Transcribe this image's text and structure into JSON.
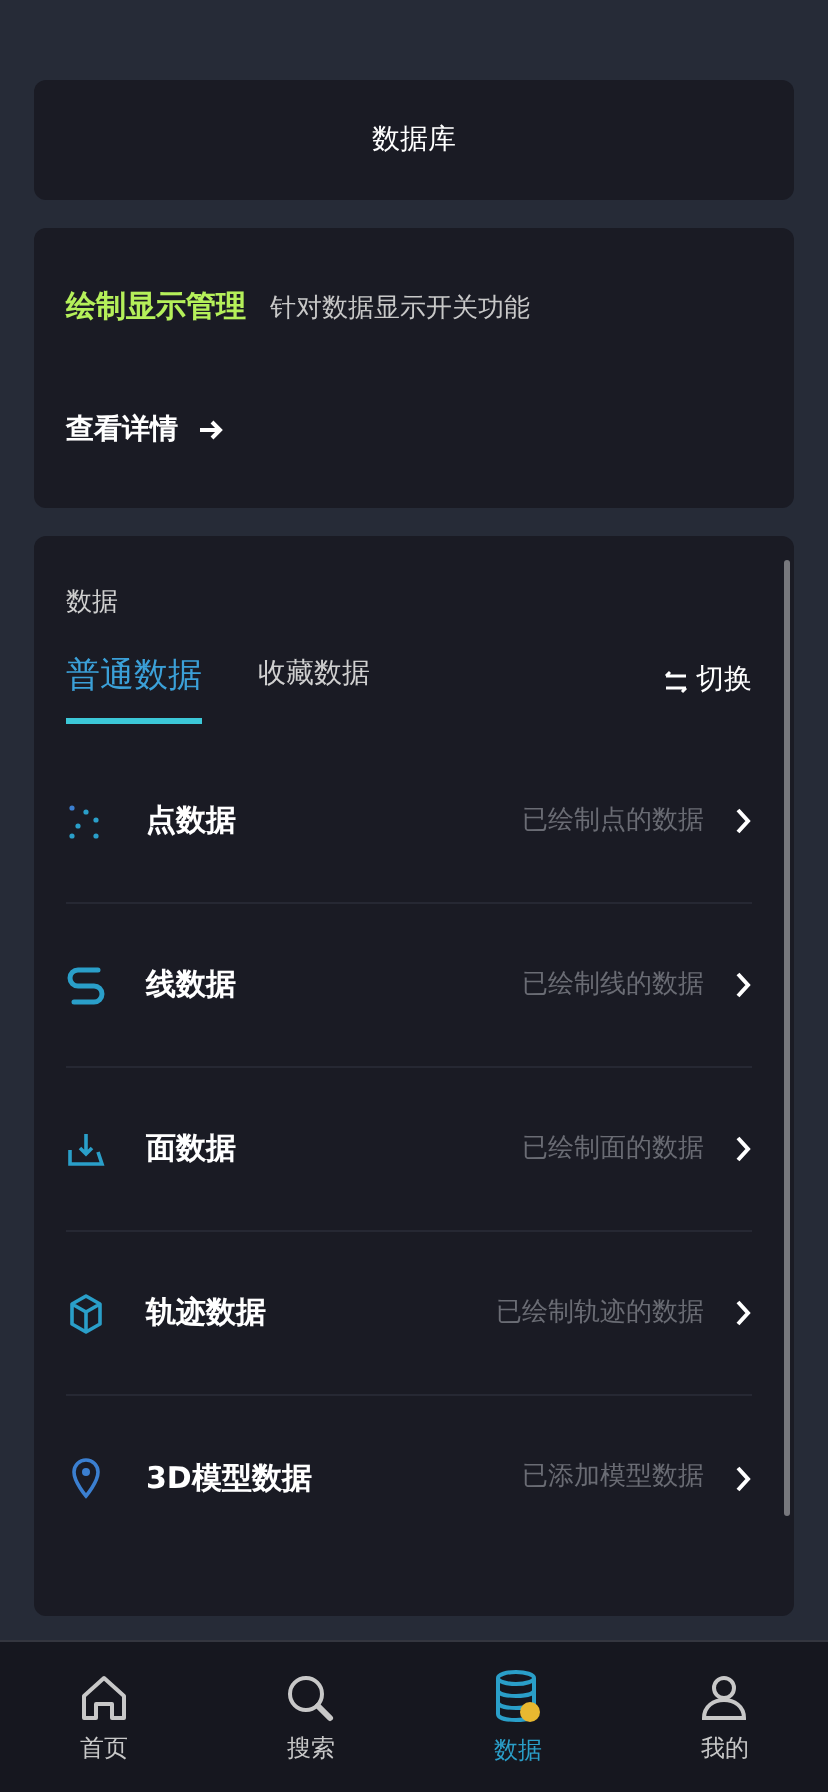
{
  "header": {
    "title": "数据库"
  },
  "draw_card": {
    "title": "绘制显示管理",
    "description": "针对数据显示开关功能",
    "link": "查看详情"
  },
  "data_panel": {
    "heading": "数据",
    "tabs": [
      {
        "label": "普通数据",
        "selected": true
      },
      {
        "label": "收藏数据",
        "selected": false
      }
    ],
    "switch_label": "切换",
    "rows": [
      {
        "kind": "point",
        "name": "点数据",
        "status": "已绘制点的数据"
      },
      {
        "kind": "line",
        "name": "线数据",
        "status": "已绘制线的数据"
      },
      {
        "kind": "area",
        "name": "面数据",
        "status": "已绘制面的数据"
      },
      {
        "kind": "track",
        "name": "轨迹数据",
        "status": "已绘制轨迹的数据"
      },
      {
        "kind": "model",
        "name": "3D模型数据",
        "status": "已添加模型数据"
      }
    ]
  },
  "bottom_nav": [
    {
      "kind": "home",
      "label": "首页",
      "selected": false
    },
    {
      "kind": "search",
      "label": "搜索",
      "selected": false
    },
    {
      "kind": "data",
      "label": "数据",
      "selected": true
    },
    {
      "kind": "profile",
      "label": "我的",
      "selected": false
    }
  ]
}
